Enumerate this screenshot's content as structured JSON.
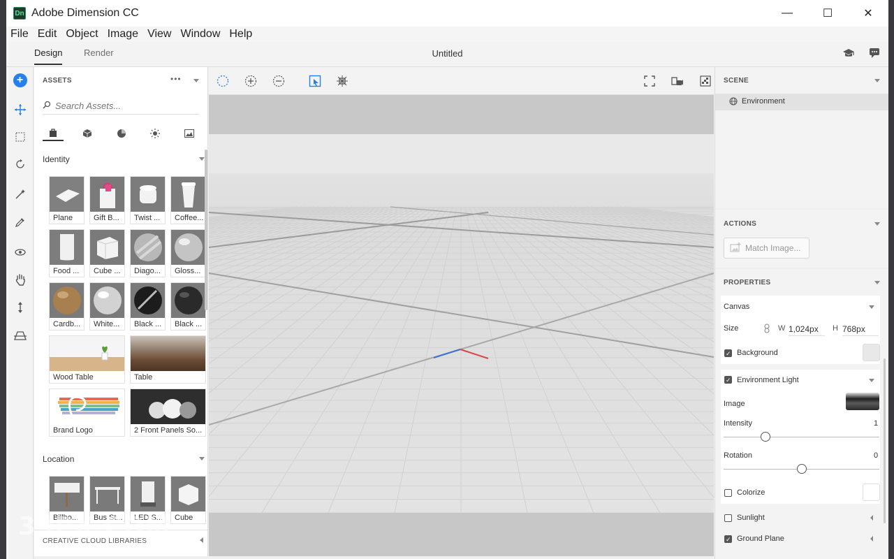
{
  "window": {
    "app_title": "Adobe Dimension CC",
    "logo_text": "Dn",
    "controls": {
      "minimize": "—",
      "maximize": "☐",
      "close": "✕"
    }
  },
  "menu": [
    "File",
    "Edit",
    "Object",
    "Image",
    "View",
    "Window",
    "Help"
  ],
  "modebar": {
    "tabs": [
      {
        "label": "Design",
        "active": true
      },
      {
        "label": "Render",
        "active": false
      }
    ],
    "doc_title": "Untitled",
    "icons": [
      "learn-icon",
      "feedback-icon"
    ]
  },
  "toolbar": {
    "tools": [
      "add-icon",
      "move-icon",
      "select-icon",
      "orbit-icon",
      "magic-wand-icon",
      "eyedropper-icon",
      "orbit-camera-icon",
      "pan-icon",
      "dolly-icon",
      "horizon-icon"
    ]
  },
  "assets": {
    "header": "ASSETS",
    "more": "•••",
    "search_placeholder": "Search Assets...",
    "categories": [
      "models-icon",
      "cube-icon",
      "materials-icon",
      "light-icon",
      "image-icon"
    ],
    "sections": [
      {
        "title": "Identity",
        "items": [
          "Plane",
          "Gift B...",
          "Twist ...",
          "Coffee...",
          "Food ...",
          "Cube ...",
          "Diago...",
          "Gloss...",
          "Cardb...",
          "White...",
          "Black ...",
          "Black ..."
        ],
        "wide_items": [
          "Wood Table",
          "Table",
          "Brand Logo",
          "2 Front Panels So..."
        ]
      },
      {
        "title": "Location",
        "items": [
          "Billbo...",
          "Bus St...",
          "LED S...",
          "Cube"
        ]
      }
    ],
    "cc_libraries": "CREATIVE CLOUD LIBRARIES"
  },
  "viewport_tools": [
    "marquee-select-icon",
    "zoom-in-icon",
    "zoom-out-icon",
    "frame-selection-icon",
    "scene-graph-icon",
    "fullscreen-icon",
    "camera-bookmark-icon",
    "render-preview-icon"
  ],
  "scene": {
    "header": "SCENE",
    "items": [
      "Environment"
    ]
  },
  "actions": {
    "header": "ACTIONS",
    "match_image": "Match Image..."
  },
  "properties": {
    "header": "PROPERTIES",
    "canvas": {
      "title": "Canvas",
      "size_label": "Size",
      "w_label": "W",
      "w_value": "1,024px",
      "h_label": "H",
      "h_value": "768px",
      "background_label": "Background",
      "background_checked": true,
      "background_color": "#e8e8e8"
    },
    "environment_light": {
      "title": "Environment Light",
      "checked": true,
      "image_label": "Image",
      "intensity_label": "Intensity",
      "intensity_value": "1",
      "intensity_level": 0.27,
      "rotation_label": "Rotation",
      "rotation_value": "0",
      "rotation_level": 0.5,
      "colorize_label": "Colorize",
      "colorize_checked": false
    },
    "sunlight": {
      "label": "Sunlight",
      "checked": false
    },
    "ground_plane": {
      "label": "Ground Plane",
      "checked": true
    }
  },
  "watermark": "39PX.COM",
  "colors": {
    "accent": "#2680eb",
    "axis_x": "#d9464a",
    "axis_z": "#3a72d6"
  }
}
